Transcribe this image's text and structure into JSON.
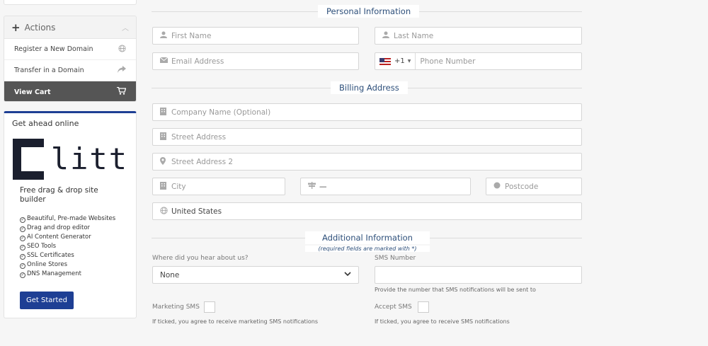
{
  "sidebar": {
    "actions_title": "Actions",
    "items": [
      {
        "label": "Register a New Domain",
        "icon": "globe-icon"
      },
      {
        "label": "Transfer in a Domain",
        "icon": "share-arrow-icon"
      },
      {
        "label": "View Cart",
        "icon": "cart-icon"
      }
    ],
    "promo": {
      "title": "Get ahead online",
      "logo_text": "litt",
      "subtitle": "Free drag & drop site builder",
      "features": [
        "Beautiful, Pre-made Websites",
        "Drag and drop editor",
        "AI Content Generator",
        "SEO Tools",
        "SSL Certificates",
        "Online Stores",
        "DNS Management"
      ],
      "button": "Get Started"
    }
  },
  "form": {
    "personal_title": "Personal Information",
    "first_name": "First Name",
    "last_name": "Last Name",
    "email": "Email Address",
    "phone_code": "+1",
    "phone": "Phone Number",
    "billing_title": "Billing Address",
    "company": "Company Name (Optional)",
    "street": "Street Address",
    "street2": "Street Address 2",
    "city": "City",
    "state": "—",
    "postcode": "Postcode",
    "country": "United States",
    "additional_title": "Additional Information",
    "required_note": "(required fields are marked with *)",
    "hear_label": "Where did you hear about us?",
    "hear_value": "None",
    "sms_label": "SMS Number",
    "sms_help": "Provide the number that SMS notifications will be sent to",
    "marketing_sms_label": "Marketing SMS",
    "marketing_sms_help": "If ticked, you agree to receive marketing SMS notifications",
    "accept_sms_label": "Accept SMS",
    "accept_sms_help": "If ticked, you agree to receive SMS notifications"
  },
  "colors": {
    "accent": "#1e3f94",
    "section_title": "#2d4f7a",
    "active_item": "#555555"
  }
}
